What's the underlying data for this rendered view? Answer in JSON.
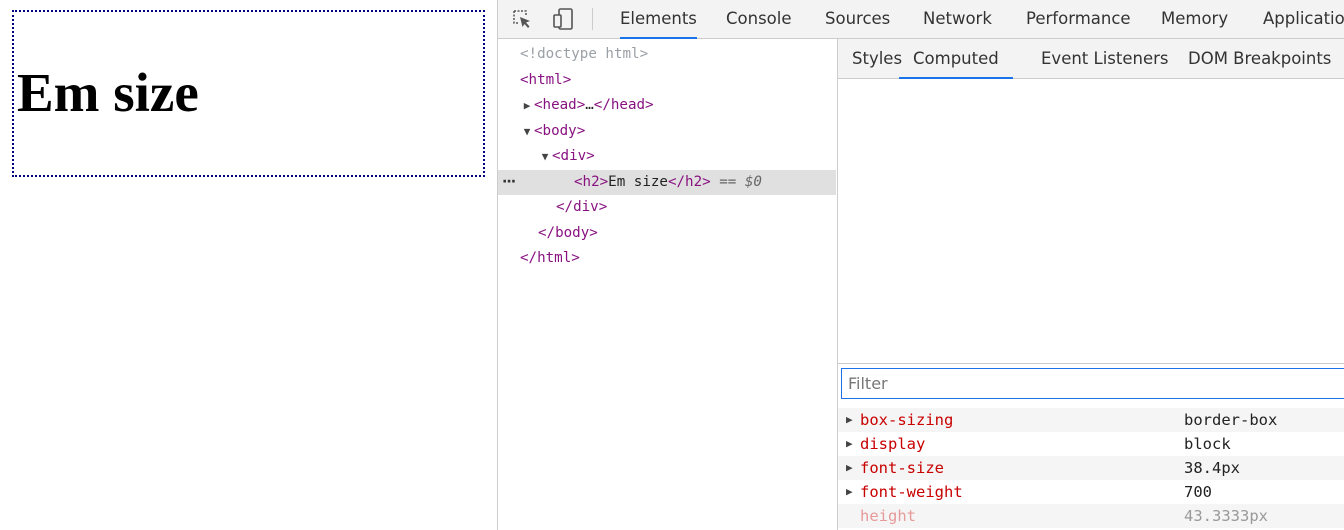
{
  "preview": {
    "heading": "Em size",
    "box_border_color": "#000080"
  },
  "devtools": {
    "toolbar_icons": [
      "inspect-element-icon",
      "device-toggle-icon"
    ],
    "main_tabs": [
      {
        "label": "Elements",
        "active": true
      },
      {
        "label": "Console",
        "active": false
      },
      {
        "label": "Sources",
        "active": false
      },
      {
        "label": "Network",
        "active": false
      },
      {
        "label": "Performance",
        "active": false
      },
      {
        "label": "Memory",
        "active": false
      },
      {
        "label": "Applicatio",
        "active": false
      }
    ],
    "dom_tree": {
      "doctype": "<!doctype html>",
      "html_open": "<html>",
      "head_open": "<head>",
      "head_ellipsis": "…",
      "head_close": "</head>",
      "body_open": "<body>",
      "div_open": "<div>",
      "h2_open": "<h2>",
      "h2_text": "Em size",
      "h2_close": "</h2>",
      "selected_marker": "== $0",
      "selected_dots": "···",
      "div_close": "</div>",
      "body_close": "</body>",
      "html_close": "</html>"
    },
    "side_tabs": [
      {
        "label": "Styles",
        "active": false
      },
      {
        "label": "Computed",
        "active": true
      },
      {
        "label": "Event Listeners",
        "active": false
      },
      {
        "label": "DOM Breakpoints",
        "active": false
      }
    ],
    "filter": {
      "placeholder": "Filter",
      "value": ""
    },
    "computed_properties": [
      {
        "name": "box-sizing",
        "value": "border-box",
        "expandable": true,
        "inherited": false
      },
      {
        "name": "display",
        "value": "block",
        "expandable": true,
        "inherited": false
      },
      {
        "name": "font-size",
        "value": "38.4px",
        "expandable": true,
        "inherited": false
      },
      {
        "name": "font-weight",
        "value": "700",
        "expandable": true,
        "inherited": false
      },
      {
        "name": "height",
        "value": "43.3333px",
        "expandable": false,
        "inherited": true
      }
    ],
    "accent_color": "#1a73e8",
    "tag_color": "#881280",
    "prop_name_color": "#c80000"
  }
}
